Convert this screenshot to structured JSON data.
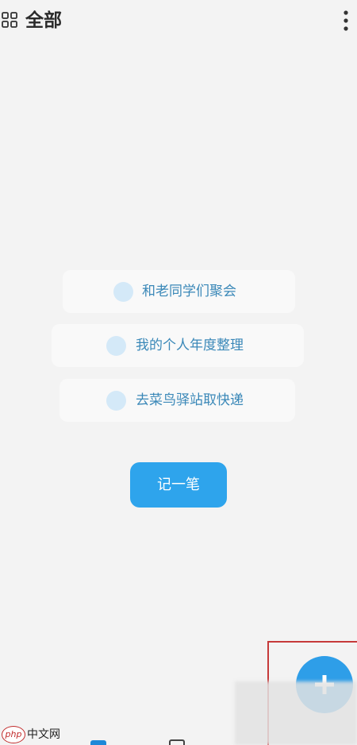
{
  "header": {
    "title": "全部",
    "menu_icon": "grid-icon",
    "more_icon": "more-vertical-icon"
  },
  "suggestions": [
    {
      "label": "和老同学们聚会"
    },
    {
      "label": "我的个人年度整理"
    },
    {
      "label": "去菜鸟驿站取快递"
    }
  ],
  "note_button": {
    "label": "记一笔"
  },
  "fab": {
    "icon": "plus-icon"
  },
  "watermark": {
    "logo": "php",
    "site": "中文网"
  },
  "colors": {
    "accent": "#2ea4ec",
    "suggestion_text": "#3a88b8",
    "suggestion_dot": "#d4e9f8",
    "highlight": "#c63a3a",
    "background": "#f3f3f3"
  }
}
